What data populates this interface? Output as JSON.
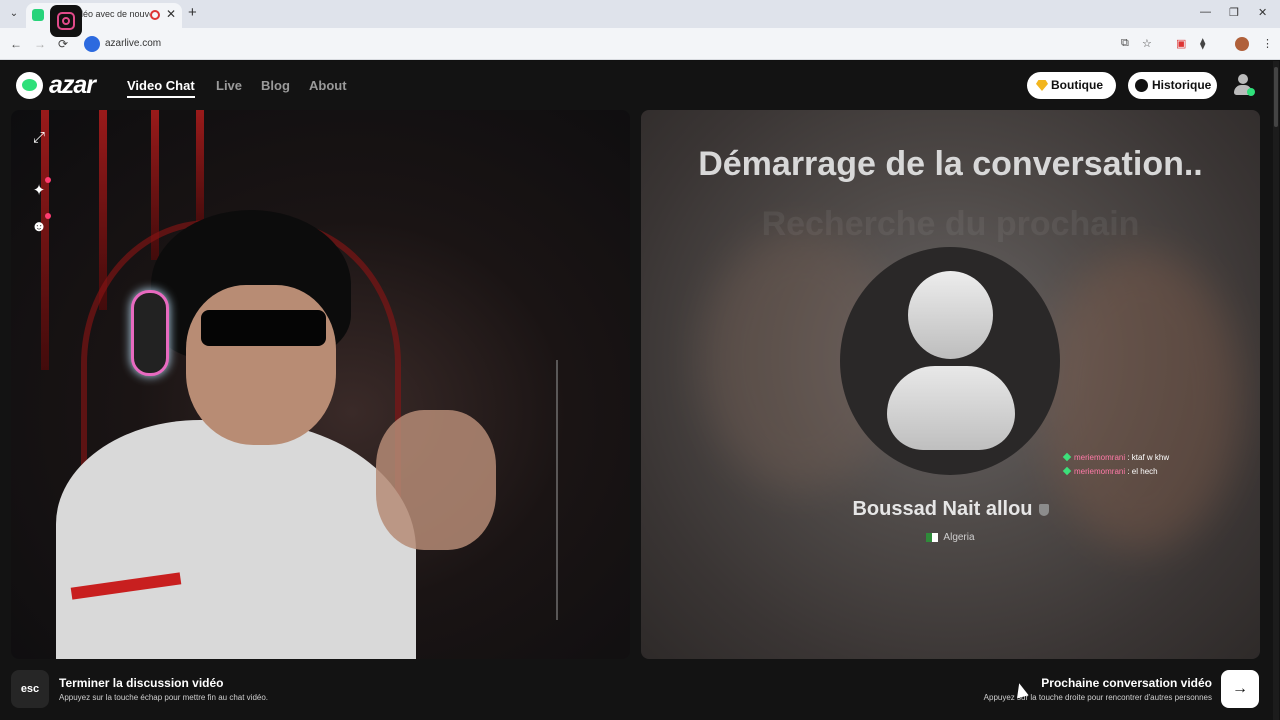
{
  "browser": {
    "tab_title": "Chat vidéo avec de nouvelles personnes",
    "tab_close": "✕",
    "new_tab": "+",
    "url": "azarlive.com",
    "icons": [
      "tab-menu-icon",
      "recording-icon",
      "back-icon",
      "forward-icon",
      "reload-icon",
      "site-icon",
      "cast-icon",
      "star-icon",
      "extension-icon",
      "puzzle-icon",
      "profile-icon",
      "kebab-menu-icon",
      "instagram-icon"
    ],
    "controls": {
      "back": "←",
      "forward": "→",
      "reload": "⟳",
      "minimize": "—",
      "restore": "❐",
      "close": "✕",
      "cast": "⧉",
      "star": "☆",
      "ext": "▣",
      "puzzle": "⧫",
      "more": "⋮",
      "menu": "⌄"
    }
  },
  "header": {
    "logo_text": "azar",
    "nav": [
      {
        "label": "Video Chat",
        "active": true
      },
      {
        "label": "Live",
        "active": false
      },
      {
        "label": "Blog",
        "active": false
      },
      {
        "label": "About",
        "active": false
      }
    ],
    "shop_label": "Boutique",
    "history_label": "Historique"
  },
  "left_video": {
    "side_icons": [
      {
        "icon": "expand-icon",
        "glyph": "⤢"
      },
      {
        "icon": "sparkle-effects-icon",
        "glyph": "✦"
      },
      {
        "icon": "face-mask-icon",
        "glyph": "☻"
      }
    ]
  },
  "right_video": {
    "status_title": "Démarrage de la conversation..",
    "ghost_text": "Recherche du prochain",
    "chat": [
      {
        "user": "meriemomrani",
        "text": ": ktaf w khw"
      },
      {
        "user": "meriemomrani",
        "text": ": el hech"
      }
    ],
    "partner_name": "Boussad Nait allou",
    "country": "Algeria"
  },
  "footer": {
    "esc_key": "esc",
    "end_title": "Terminer la discussion vidéo",
    "end_sub": "Appuyez sur la touche échap pour mettre fin au chat vidéo.",
    "next_title": "Prochaine conversation vidéo",
    "next_sub": "Appuyez sur la touche droite pour rencontrer d'autres personnes",
    "next_arrow": "→"
  },
  "colors": {
    "brand_green": "#2fe07a",
    "background": "#131313",
    "accent_pink": "#ff3d71",
    "gem_gold": "#f2b51d"
  }
}
